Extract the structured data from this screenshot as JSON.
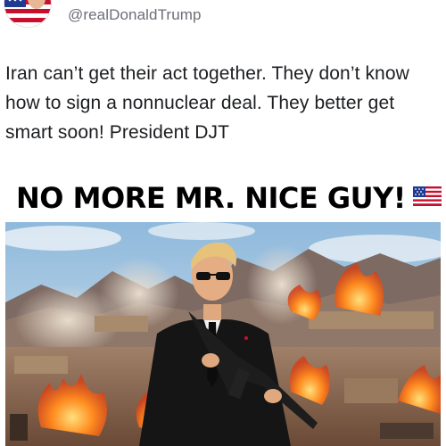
{
  "post": {
    "handle": "@realDonaldTrump",
    "text": "Iran can’t get their act together. They don’t know how to sign a nonnuclear deal. They better get smart soon! President DJT"
  },
  "meme": {
    "caption": "NO MORE MR. NICE GUY!",
    "flag_icon": "us-flag-icon",
    "scene": "man-in-dark-suit-holding-rifle-in-front-of-explosions-and-mountains"
  },
  "colors": {
    "handle": "#6b6f76",
    "text": "#1c1e21",
    "caption": "#000000",
    "fire": "#ff7a1a",
    "sky": "#b9d6ea"
  }
}
